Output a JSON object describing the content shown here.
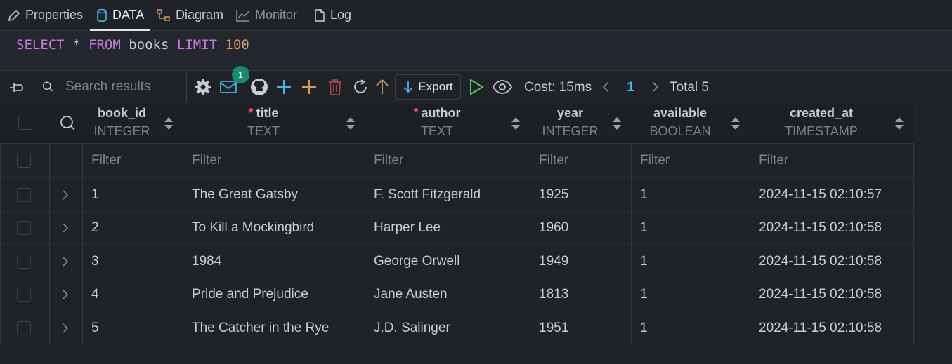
{
  "tabs": [
    {
      "label": "Properties",
      "icon": "pencil-icon"
    },
    {
      "label": "DATA",
      "icon": "database-icon"
    },
    {
      "label": "Diagram",
      "icon": "diagram-icon"
    },
    {
      "label": "Monitor",
      "icon": "monitor-icon"
    },
    {
      "label": "Log",
      "icon": "file-icon"
    }
  ],
  "sql": {
    "select": "SELECT",
    "star": "*",
    "from": "FROM",
    "table": "books",
    "limit": "LIMIT",
    "count": "100"
  },
  "toolbar": {
    "search_placeholder": "Search results",
    "notification_count": "1",
    "export_label": "Export",
    "cost": "Cost: 15ms",
    "page": "1",
    "total": "Total 5"
  },
  "columns": [
    {
      "name": "book_id",
      "type": "INTEGER",
      "required": false
    },
    {
      "name": "title",
      "type": "TEXT",
      "required": true
    },
    {
      "name": "author",
      "type": "TEXT",
      "required": true
    },
    {
      "name": "year",
      "type": "INTEGER",
      "required": false
    },
    {
      "name": "available",
      "type": "BOOLEAN",
      "required": false
    },
    {
      "name": "created_at",
      "type": "TIMESTAMP",
      "required": false
    }
  ],
  "filter_placeholder": "Filter",
  "rows": [
    [
      "1",
      "The Great Gatsby",
      "F. Scott Fitzgerald",
      "1925",
      "1",
      "2024-11-15 02:10:57"
    ],
    [
      "2",
      "To Kill a Mockingbird",
      "Harper Lee",
      "1960",
      "1",
      "2024-11-15 02:10:58"
    ],
    [
      "3",
      "1984",
      "George Orwell",
      "1949",
      "1",
      "2024-11-15 02:10:58"
    ],
    [
      "4",
      "Pride and Prejudice",
      "Jane Austen",
      "1813",
      "1",
      "2024-11-15 02:10:58"
    ],
    [
      "5",
      "The Catcher in the Rye",
      "J.D. Salinger",
      "1951",
      "1",
      "2024-11-15 02:10:58"
    ]
  ],
  "colors": {
    "accent": "#4ab3e8",
    "keyword": "#c678dd",
    "number": "#d19a66",
    "badge": "#1a8a6e",
    "required": "#e5534b"
  }
}
